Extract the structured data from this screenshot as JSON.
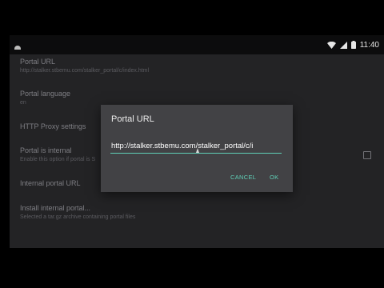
{
  "status_bar": {
    "time": "11:40",
    "icons": [
      "notification-icon",
      "wifi-icon",
      "signal-icon",
      "battery-icon"
    ]
  },
  "settings": {
    "items": [
      {
        "title": "Portal URL",
        "summary": "http://stalker.stbemu.com/stalker_portal/c/index.html"
      },
      {
        "title": "Portal language",
        "summary": "en"
      },
      {
        "title": "HTTP Proxy settings",
        "summary": ""
      },
      {
        "title": "Portal is internal",
        "summary": "Enable this option if portal is S"
      },
      {
        "title": "Internal portal URL",
        "summary": ""
      },
      {
        "title": "Install internal portal...",
        "summary": "Selected a tar.gz archive containing portal files"
      }
    ],
    "checkbox_checked": false
  },
  "dialog": {
    "title": "Portal URL",
    "input_value": "http://stalker.stbemu.com/stalker_portal/c/i",
    "cancel_label": "CANCEL",
    "ok_label": "OK"
  },
  "colors": {
    "accent": "#5fcfb6",
    "background": "#2b2b2e",
    "dialog": "#424245"
  }
}
